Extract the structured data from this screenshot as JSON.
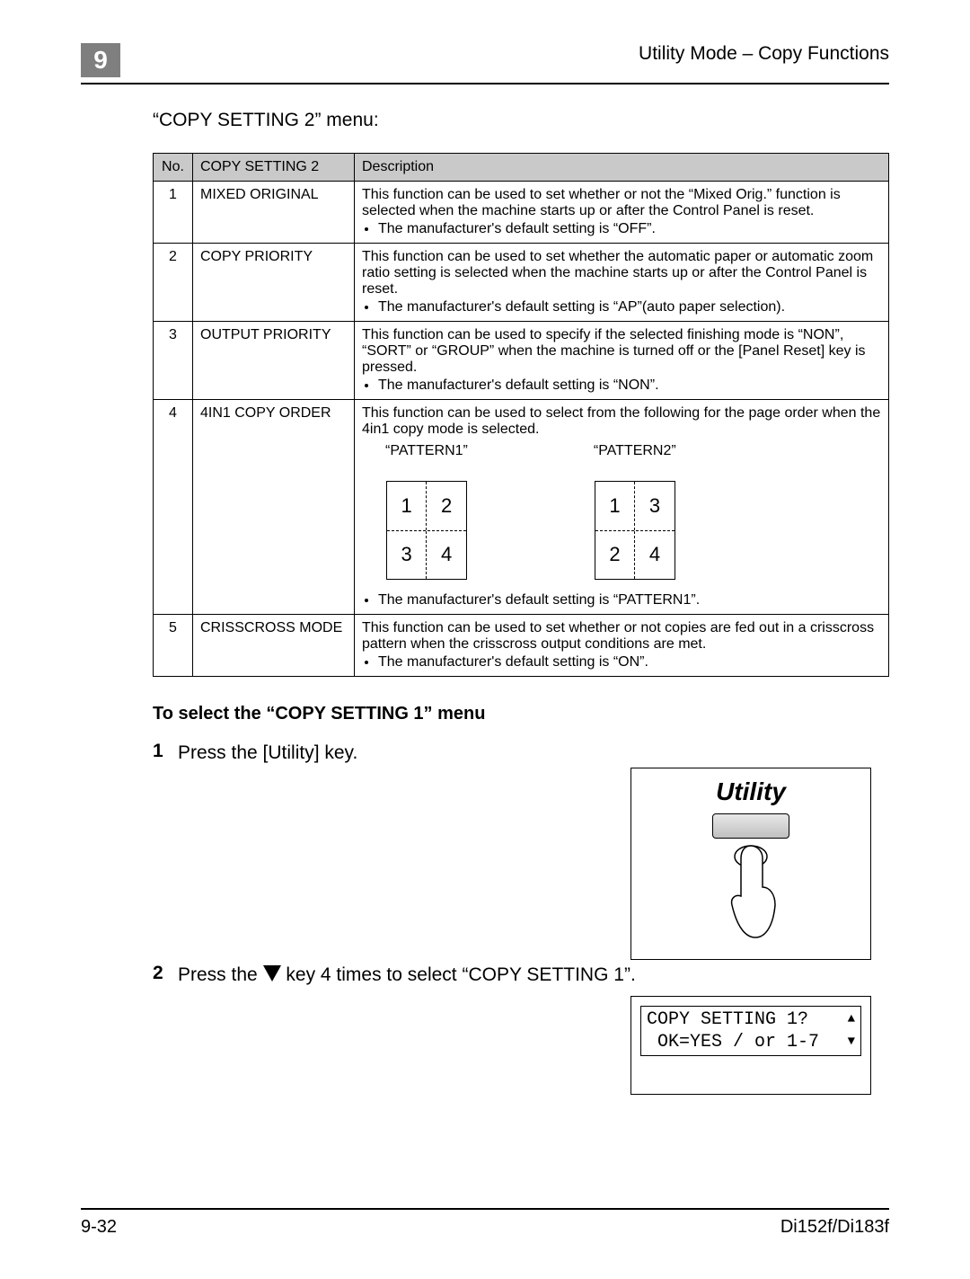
{
  "header": {
    "chapter_number": "9",
    "title": "Utility Mode – Copy Functions"
  },
  "menu_title": "“COPY SETTING 2” menu:",
  "table": {
    "headers": {
      "no": "No.",
      "name": "COPY SETTING 2",
      "desc": "Description"
    },
    "rows": [
      {
        "no": "1",
        "name": "MIXED ORIGINAL",
        "desc_main": "This function can be used to set whether or not the “Mixed Orig.” function is selected when the machine starts up or after the Control Panel is reset.",
        "bullets": [
          "The manufacturer's default setting is “OFF”."
        ]
      },
      {
        "no": "2",
        "name": "COPY PRIORITY",
        "desc_main": "This function can be used to set whether the automatic paper or automatic zoom ratio setting is selected when the machine starts up or after the Control Panel is reset.",
        "bullets": [
          "The manufacturer's default setting is “AP”(auto paper selection)."
        ]
      },
      {
        "no": "3",
        "name": "OUTPUT PRIORITY",
        "desc_main": "This function can be used to specify if the selected finishing mode is “NON”, “SORT” or “GROUP” when the machine is turned off or the [Panel Reset] key is pressed.",
        "bullets": [
          "The manufacturer's default setting is “NON”."
        ]
      },
      {
        "no": "4",
        "name": "4IN1 COPY ORDER",
        "desc_main": "This function can be used to select from the following for the page order when the 4in1 copy mode is selected.",
        "patterns": {
          "p1_label": "“PATTERN1”",
          "p2_label": "“PATTERN2”",
          "p1": [
            "1",
            "2",
            "3",
            "4"
          ],
          "p2": [
            "1",
            "3",
            "2",
            "4"
          ]
        },
        "bullets": [
          "The manufacturer's default setting is “PATTERN1”."
        ]
      },
      {
        "no": "5",
        "name": "CRISSCROSS MODE",
        "desc_main": "This function can be used to set whether or not copies are fed out in a crisscross pattern when the crisscross output conditions are met.",
        "bullets": [
          "The manufacturer's default setting is “ON”."
        ]
      }
    ]
  },
  "subhead": "To select the “COPY SETTING 1” menu",
  "steps": {
    "s1_num": "1",
    "s1_text": "Press the [Utility] key.",
    "s2_num": "2",
    "s2_text_a": "Press the ",
    "s2_text_b": " key 4 times to select “COPY SETTING 1”."
  },
  "utility_label": "Utility",
  "lcd": {
    "line1": "COPY SETTING 1?",
    "line2": " OK=YES / or 1-7"
  },
  "footer": {
    "left": "9-32",
    "right": "Di152f/Di183f"
  }
}
